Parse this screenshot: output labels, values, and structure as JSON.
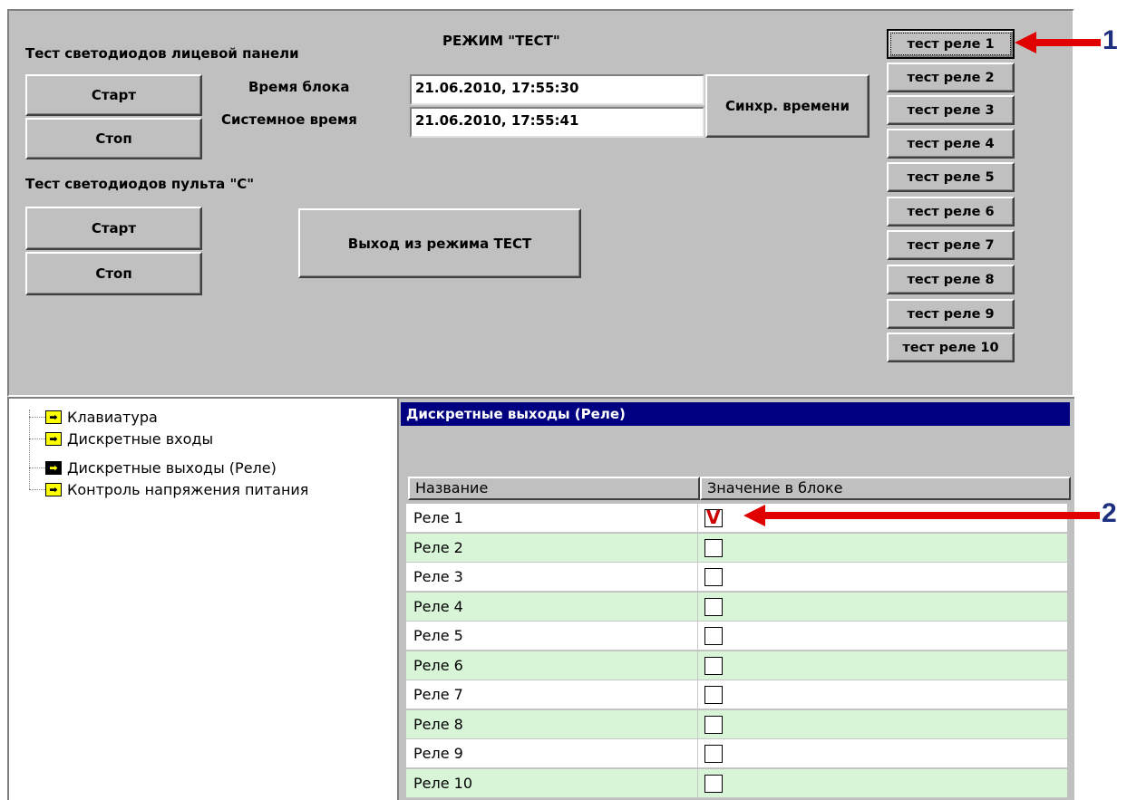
{
  "top_panel": {
    "mode_title": "РЕЖИМ \"ТЕСТ\"",
    "front_led_label": "Тест светодиодов лицевой панели",
    "remote_led_label": "Тест светодиодов пульта \"С\"",
    "start_label": "Старт",
    "stop_label": "Стоп",
    "block_time_label": "Время блока",
    "system_time_label": "Системное время",
    "block_time_value": "21.06.2010, 17:55:30",
    "system_time_value": "21.06.2010, 17:55:41",
    "sync_label": "Синхр. времени",
    "exit_label": "Выход из режима ТЕСТ",
    "relay_buttons": [
      "тест реле 1",
      "тест реле 2",
      "тест реле 3",
      "тест реле 4",
      "тест реле 5",
      "тест реле 6",
      "тест реле 7",
      "тест реле 8",
      "тест реле 9",
      "тест реле 10"
    ]
  },
  "tree": {
    "items": [
      "Клавиатура",
      "Дискретные входы",
      "Дискретные выходы (Реле)",
      "Контроль напряжения питания"
    ],
    "icons": [
      "arrow-right-icon",
      "arrow-right-icon",
      "arrow-right-icon",
      "arrow-right-icon"
    ]
  },
  "table": {
    "title": "Дискретные выходы (Реле)",
    "columns": [
      "Название",
      "Значение в блоке"
    ],
    "rows": [
      {
        "name": "Реле 1",
        "checked": true
      },
      {
        "name": "Реле 2",
        "checked": false
      },
      {
        "name": "Реле 3",
        "checked": false
      },
      {
        "name": "Реле 4",
        "checked": false
      },
      {
        "name": "Реле 5",
        "checked": false
      },
      {
        "name": "Реле 6",
        "checked": false
      },
      {
        "name": "Реле 7",
        "checked": false
      },
      {
        "name": "Реле 8",
        "checked": false
      },
      {
        "name": "Реле 9",
        "checked": false
      },
      {
        "name": "Реле 10",
        "checked": false
      }
    ],
    "row_colors": [
      "#ffffff",
      "#d8f5d8"
    ]
  },
  "callouts": {
    "one": "1",
    "two": "2"
  },
  "colors": {
    "accent_arrow": "#e00000",
    "title_bar": "#000080"
  }
}
